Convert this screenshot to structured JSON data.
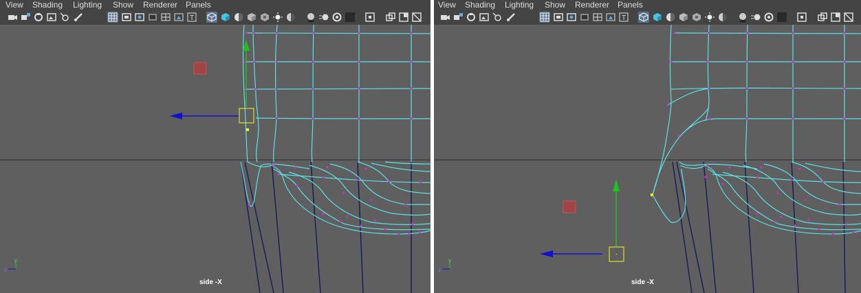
{
  "menu": [
    "View",
    "Shading",
    "Lighting",
    "Show",
    "Renderer",
    "Panels"
  ],
  "toolbar_icons": [
    "camera-icon",
    "camera-lock-icon",
    "bookmark-icon",
    "image-plane-icon",
    "camera-move-icon",
    "pencil-icon",
    "grid-icon",
    "film-gate-icon",
    "resolution-gate-icon",
    "gate-mask-icon",
    "field-chart-icon",
    "safe-action-icon",
    "safe-title-icon",
    "wireframe-icon",
    "smooth-shade-icon",
    "shade-wireframe-icon",
    "default-material-icon",
    "textured-icon",
    "lights-icon",
    "shadows-icon",
    "screen-space-ao-icon",
    "motion-blur-icon",
    "anti-aliasing-icon",
    "depth-of-field-icon",
    "isolate-select-icon",
    "xray-icon",
    "xray-joints-icon",
    "xray-components-icon"
  ],
  "viewports": [
    {
      "camera_label": "side -X",
      "axis_y": "y",
      "axis_z": "z"
    },
    {
      "camera_label": "side -X",
      "axis_y": "y",
      "axis_z": "z"
    }
  ],
  "colors": {
    "viewport_bg": "#5f5f5f",
    "toolbar_bg": "#444444",
    "wire": "#5ce1e6",
    "vertex": "#d02fd0",
    "manip_x": "#1010d0",
    "manip_y": "#20c020",
    "pivot_box": "#e0e020"
  }
}
